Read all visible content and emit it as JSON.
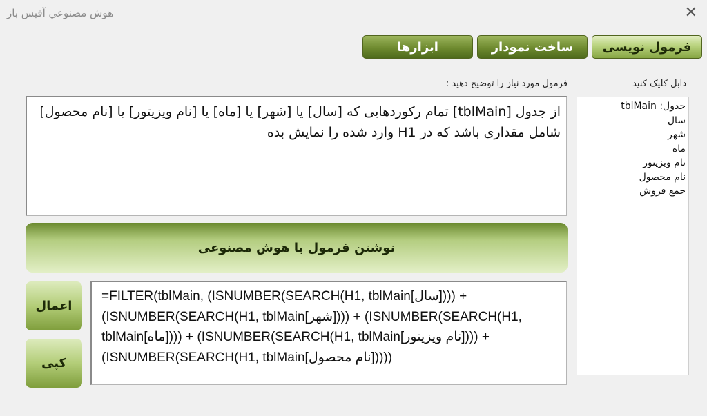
{
  "window": {
    "title": "هوش مصنوعي آفيس باز",
    "close_glyph": "✕"
  },
  "tabs": {
    "formula": "فرمول نویسی",
    "chart": "ساخت نمودار",
    "tools": "ابزارها"
  },
  "labels": {
    "fields_hint": "دابل کلیک کنید",
    "prompt_hint": "فرمول مورد نیاز را توضیح دهید :"
  },
  "fields": {
    "items": [
      "جدول: tblMain",
      "سال",
      "شهر",
      "ماه",
      "نام ویزیتور",
      "نام محصول",
      "جمع فروش"
    ]
  },
  "prompt_text": "از جدول [tblMain] تمام رکوردهایی که [سال] یا [شهر] یا [ماه] یا [نام ویزیتور] یا [نام محصول] شامل مقداری باشد که در H1 وارد شده را نمایش بده",
  "generate_label": "نوشتن فرمول با هوش مصنوعی",
  "buttons": {
    "apply": "اعمال",
    "copy": "کپی"
  },
  "formula_output": "=FILTER(tblMain, (ISNUMBER(SEARCH(H1, tblMain[سال]))) + (ISNUMBER(SEARCH(H1, tblMain[شهر]))) + (ISNUMBER(SEARCH(H1, tblMain[ماه]))) + (ISNUMBER(SEARCH(H1, tblMain[نام ویزیتور]))) + (ISNUMBER(SEARCH(H1, tblMain[نام محصول]))))"
}
